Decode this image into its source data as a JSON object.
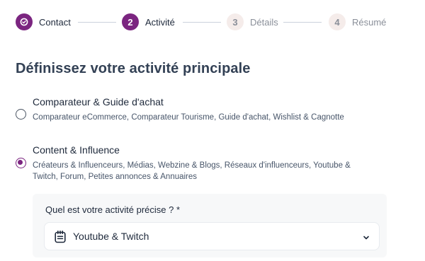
{
  "stepper": {
    "steps": [
      {
        "number": "✓",
        "label": "Contact",
        "state": "done"
      },
      {
        "number": "2",
        "label": "Activité",
        "state": "active"
      },
      {
        "number": "3",
        "label": "Détails",
        "state": "todo"
      },
      {
        "number": "4",
        "label": "Résumé",
        "state": "todo"
      }
    ]
  },
  "page": {
    "title": "Définissez votre activité principale"
  },
  "options": [
    {
      "title": "Comparateur & Guide d'achat",
      "description": "Comparateur eCommerce, Comparateur Tourisme, Guide d'achat, Wishlist & Cagnotte",
      "selected": false
    },
    {
      "title": "Content & Influence",
      "description": "Créateurs & Influenceurs, Médias, Webzine & Blogs, Réseaux d'influenceurs, Youtube & Twitch, Forum, Petites annonces & Annuaires",
      "selected": true
    }
  ],
  "detail": {
    "label": "Quel est votre activité précise ? *",
    "selected_value": "Youtube & Twitch",
    "icon": "notepad-icon"
  },
  "colors": {
    "accent": "#7b2580",
    "inactive_step_bg": "#f5ecea",
    "panel_bg": "#f7f8f9"
  }
}
